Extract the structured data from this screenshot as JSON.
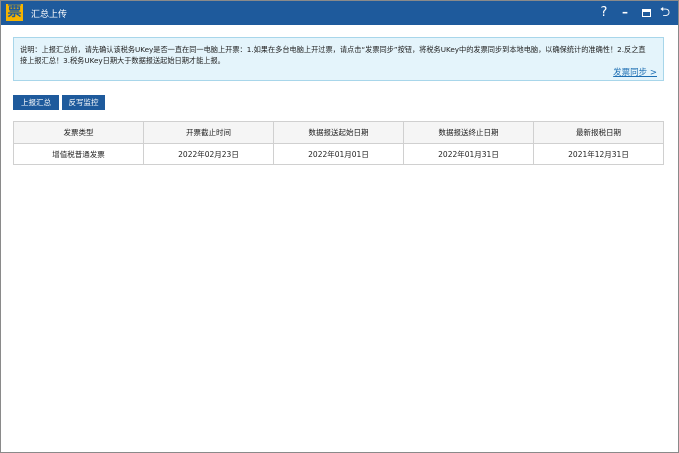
{
  "window": {
    "logo_char": "票",
    "title": "汇总上传",
    "help_glyph": "?",
    "minimize_glyph": "–",
    "back_glyph": "⮌"
  },
  "notice": {
    "text": "说明：上报汇总前，请先确认该税务UKey是否一直在同一电脑上开票：1.如果在多台电脑上开过票，请点击“发票同步”按钮，将税务UKey中的发票同步到本地电脑，以确保统计的准确性！2.反之直接上报汇总！3.税务UKey日期大于数据报送起始日期才能上报。",
    "link": "发票同步 >"
  },
  "actions": {
    "report_label": "上报汇总",
    "writeback_label": "反写监控"
  },
  "table": {
    "headers": [
      "发票类型",
      "开票截止时间",
      "数据报送起始日期",
      "数据报送终止日期",
      "最新报税日期"
    ],
    "rows": [
      [
        "增值税普通发票",
        "2022年02月23日",
        "2022年01月01日",
        "2022年01月31日",
        "2021年12月31日"
      ]
    ]
  },
  "colors": {
    "titlebar": "#1e5a9c",
    "logo": "#f5b400",
    "notice_bg": "#e4f4fb",
    "link": "#1e6fb3"
  }
}
